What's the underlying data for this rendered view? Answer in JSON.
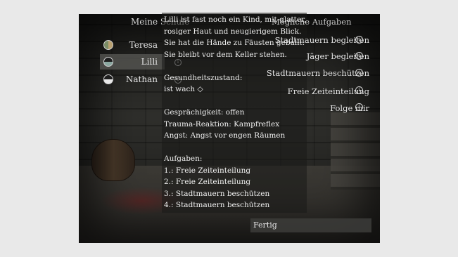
{
  "school": {
    "title": "Meine Schule",
    "members": [
      {
        "name": "Teresa",
        "selected": false
      },
      {
        "name": "Lilli",
        "selected": true
      },
      {
        "name": "Nathan",
        "selected": false
      }
    ]
  },
  "description": {
    "text": "Lilli ist fast noch ein Kind, mit glatter,\nrosiger Haut und neugierigem Blick.\nSie hat die Hände zu Fäusten geballt.\nSie bleibt vor dem Keller stehen.\n\nGesundheitszustand:\nist wach ◇\n\nGesprächigkeit: offen\nTrauma-Reaktion: Kampfreflex\nAngst: Angst vor engen Räumen\n\nAufgaben:\n1.: Freie Zeiteinteilung\n2.: Freie Zeiteinteilung\n3.: Stadtmauern beschützen\n4.: Stadtmauern beschützen"
  },
  "tasks": {
    "title": "Mögliche Aufgaben",
    "items": [
      {
        "label": "Stadtmauern begleiten"
      },
      {
        "label": "Jäger begleiten"
      },
      {
        "label": "Stadtmauern beschützen"
      },
      {
        "label": "Freie Zeiteinteilung"
      },
      {
        "label": "Folge mir"
      }
    ],
    "info_icon": "info-icon"
  },
  "actions": {
    "done_label": "Fertig"
  },
  "colors": {
    "panel": "#2b2b28",
    "selected_row": "#5a5a56",
    "text": "#e6e6e6"
  }
}
